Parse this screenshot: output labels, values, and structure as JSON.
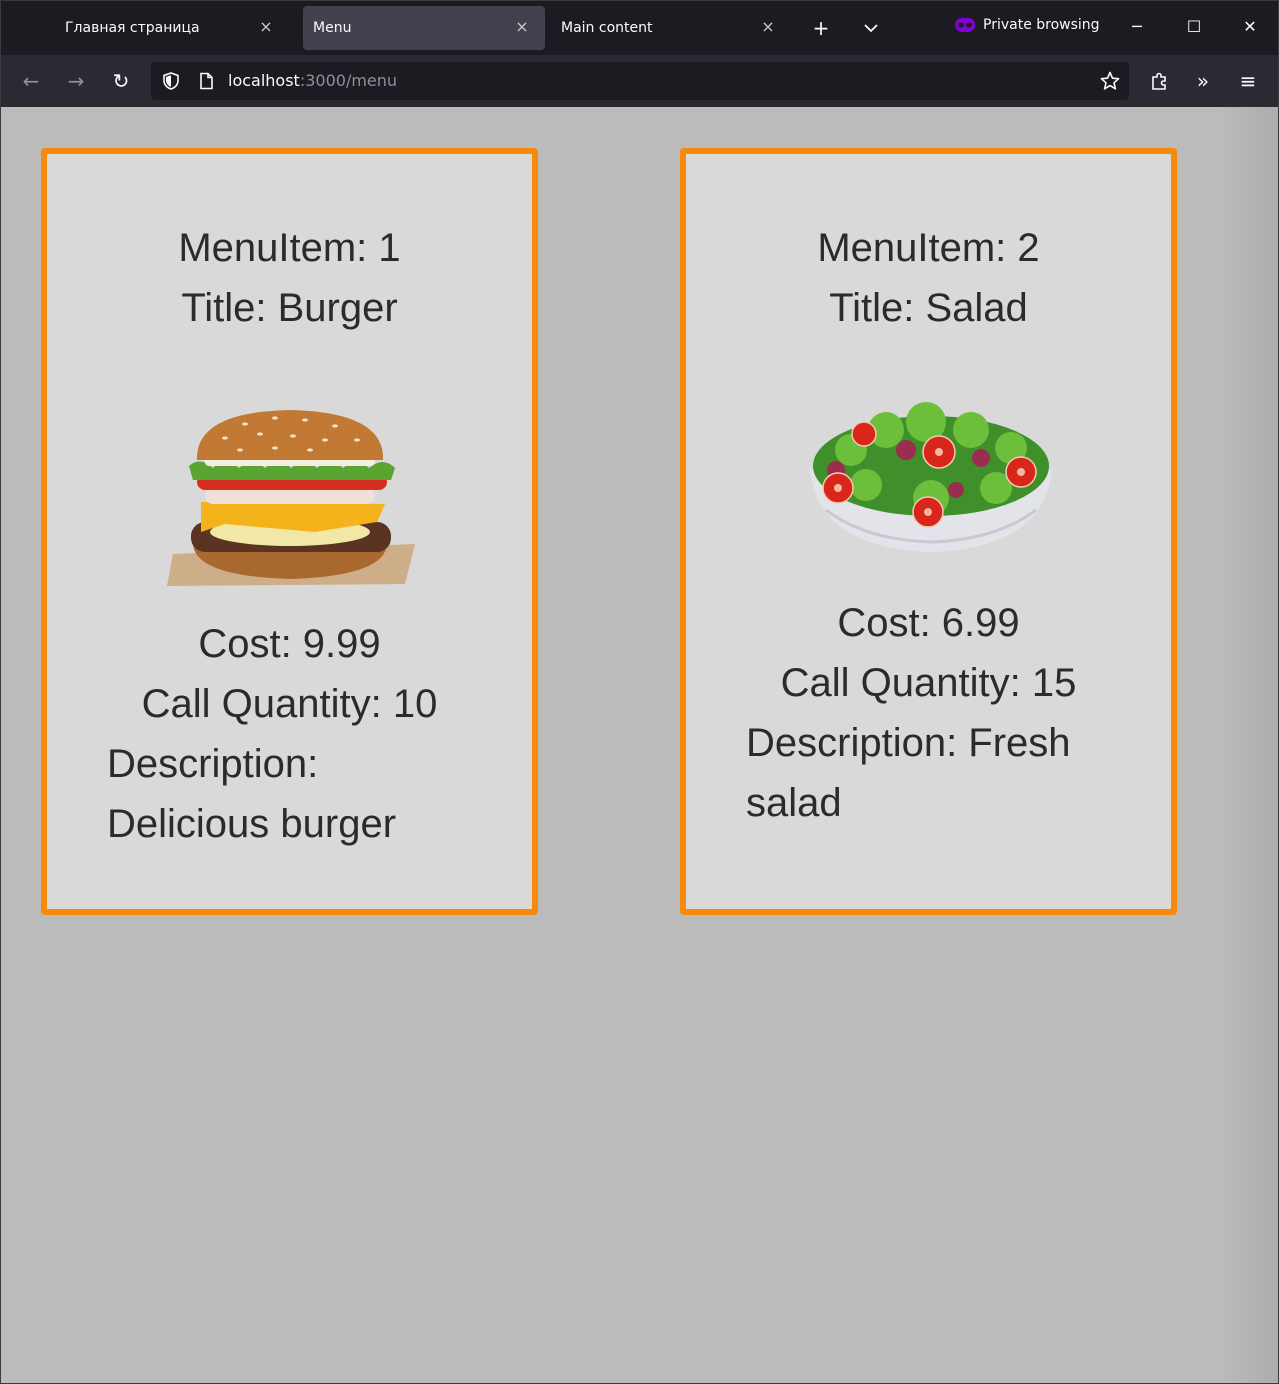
{
  "browser": {
    "tabs": [
      {
        "label": "Главная страница",
        "active": false
      },
      {
        "label": "Menu",
        "active": true
      },
      {
        "label": "Main content",
        "active": false
      }
    ],
    "private_label": "Private browsing",
    "url_host": "localhost",
    "url_rest": ":3000/menu",
    "icons": {
      "close": "×",
      "new_tab": "+",
      "list_tabs": "⌄",
      "minimize": "─",
      "maximize": "☐",
      "window_close": "✕",
      "back": "←",
      "forward": "→",
      "reload": "↻",
      "overflow": "»",
      "menu": "≡"
    }
  },
  "colors": {
    "page_bg": "#bbbbbb",
    "card_bg": "#d9d9d9",
    "card_border": "#f58a0c",
    "private_accent": "#8000d7"
  },
  "menu_items": [
    {
      "id_line": "MenuItem: 1",
      "title_line": "Title: Burger",
      "image": "burger-image",
      "cost_line": "Cost: 9.99",
      "quantity_line": "Call Quantity: 10",
      "description_line": "Description: Delicious burger"
    },
    {
      "id_line": "MenuItem: 2",
      "title_line": "Title: Salad",
      "image": "salad-bowl-image",
      "cost_line": "Cost: 6.99",
      "quantity_line": "Call Quantity: 15",
      "description_line": "Description: Fresh salad"
    }
  ]
}
